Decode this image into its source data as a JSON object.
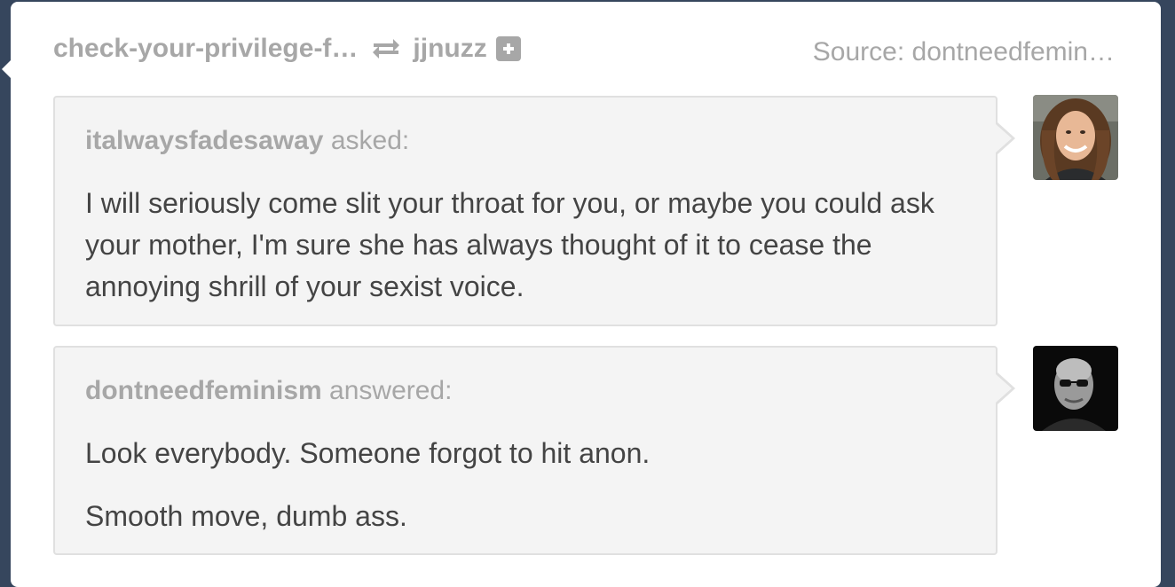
{
  "header": {
    "blog_name": "check-your-privilege-f…",
    "reblog_icon": "reblog-icon",
    "reblogger": "jjnuzz",
    "follow_icon": "plus-icon",
    "source": "Source: dontneedfemin…"
  },
  "ask": {
    "username": "italwaysfadesaway",
    "verb": " asked:",
    "text": "I will seriously come slit your throat for you, or maybe you could ask your mother, I'm sure she has always thought of it to cease the annoying shrill of your sexist voice."
  },
  "answer": {
    "username": "dontneedfeminism",
    "verb": " answered:",
    "paragraphs": [
      "Look everybody. Someone forgot to hit anon.",
      "Smooth move, dumb ass."
    ]
  },
  "colors": {
    "background": "#36465d",
    "card": "#ffffff",
    "bubble": "#f4f4f4",
    "muted_text": "#a7a7a7",
    "body_text": "#444444"
  }
}
